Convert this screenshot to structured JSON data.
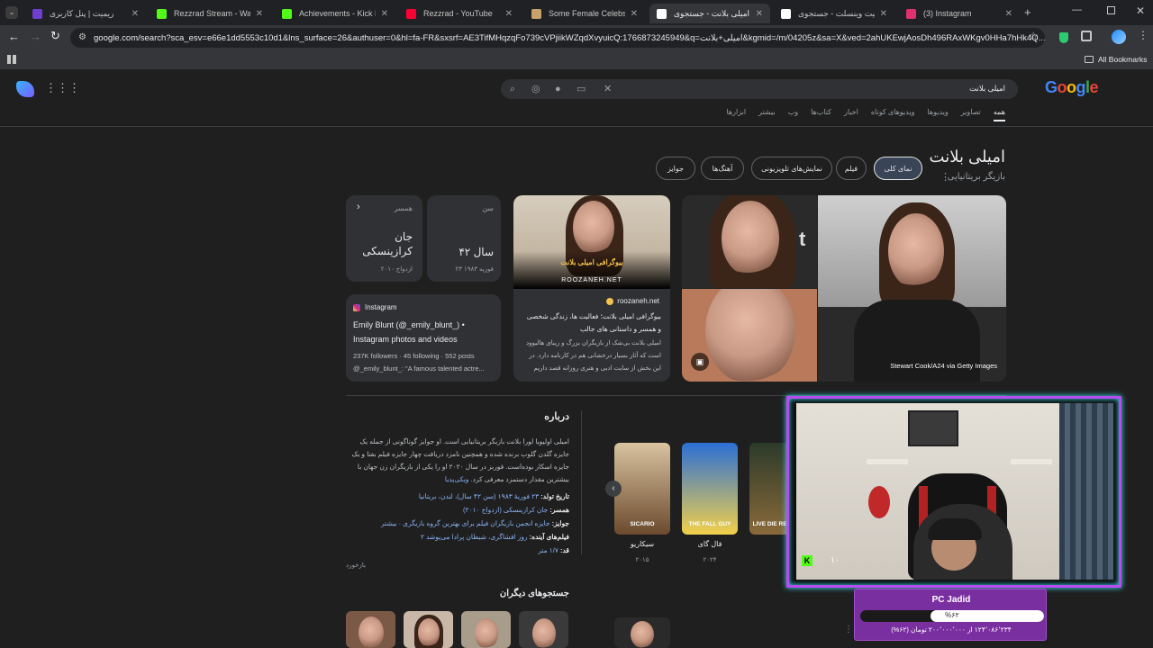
{
  "tabs": [
    {
      "title": "ریمیت | پنل کاربری",
      "color": "#6f3fd1",
      "active": false
    },
    {
      "title": "Rezzrad Stream - Watch L",
      "color": "#53fc18",
      "active": false
    },
    {
      "title": "Achievements - Kick Dash",
      "color": "#53fc18",
      "active": false
    },
    {
      "title": "Rezzrad - YouTube",
      "color": "#ff0033",
      "active": false
    },
    {
      "title": "Some Female Celebs",
      "color": "#c9a26a",
      "active": false
    },
    {
      "title": "امیلی بلانت - جستجوی Goo",
      "color": "#ffffff",
      "active": true
    },
    {
      "title": "کیت وینسلت - جستجوی Goo",
      "color": "#ffffff",
      "active": false
    },
    {
      "title": "(3) Instagram",
      "color": "#e1306c",
      "active": false
    }
  ],
  "address_bar": {
    "url": "google.com/search?sca_esv=e66e1dd5553c10d1&lns_surface=26&authuser=0&hl=fa-FR&sxsrf=AE3TifMHqzqFo739cVPjiikWZqdXvyuicQ:1766873245949&q=امیلی+بلانت&kgmid=/m/04205z&sa=X&ved=2ahUKEwjAosDh496RAxWKgv0HHa7hHk4Q..."
  },
  "bookmarks": {
    "all_label": "All Bookmarks"
  },
  "search": {
    "query": "امیلی بلانت",
    "logo": "Google"
  },
  "nav_tabs": [
    "همه",
    "تصاویر",
    "ویدیوها",
    "ویدیوهای کوتاه",
    "اخبار",
    "کتاب‌ها",
    "وب",
    "بیشتر",
    "ابزارها"
  ],
  "entity": {
    "title": "امیلی بلانت",
    "subtitle": "بازیگر بریتانیایی",
    "chips": [
      "نمای کلی",
      "فیلم",
      "نمایش‌های تلویزیونی",
      "آهنگ‌ها",
      "جوایز"
    ]
  },
  "info_cards": {
    "age": {
      "label": "سن",
      "value": "۴۲ سال",
      "sub": "۲۳ فوریه ۱۹۸۳"
    },
    "spouse": {
      "label": "همسر",
      "value": "جان کرازینسکی",
      "sub": "ازدواج ۲۰۱۰"
    }
  },
  "instagram_card": {
    "source": "Instagram",
    "title": "Emily Blunt (@_emily_blunt_) • Instagram photos and videos",
    "stats": "237K followers · 45 following · 552 posts",
    "snippet": "@_emily_blunt_: \"A famous talented actre..."
  },
  "article_card": {
    "banner": "بیوگرافی امیلی بلانت",
    "watermark": "ROOZANEH.NET",
    "source": "roozaneh.net",
    "title": "بیوگرافی امیلی بلانت؛ فعالیت ها، زندگی شخصی و همسر و داستانی های جالب",
    "snippet": "امیلی بلانت بی‌شک از بازیگران بزرگ و زیبای هالیوود است که آثار بسیار درخشانی هم در کارنامه دارد. در این بخش از سایت ادبی و هنری روزانه قصد داریم نگاهی..."
  },
  "photo_credit": "Stewart Cook/A24 via Getty Images",
  "about": {
    "heading": "درباره",
    "text": "امیلی اولیویا لورا بلانت بازیگر بریتانیایی است. او جوایز گوناگونی از جمله یک جایزه گلدن گلوب برنده شده و همچنین نامزد دریافت چهار جایزه فیلم بفتا و یک جایزه اسکار بوده‌است. فوربز در سال ۲۰۲۰ او را یکی از بازیگران زن جهان با بیشترین مقدار دستمزد معرفی کرد.",
    "link": "ویکی‌پدیا",
    "facts": [
      {
        "label": "تاریخ تولد:",
        "value": "۲۳ فوریهٔ ۱۹۸۳ (سن ۴۲ سال)، لندن، بریتانیا"
      },
      {
        "label": "همسر:",
        "value": "جان کرازینسکی (ازدواج ۲۰۱۰)"
      },
      {
        "label": "جوایز:",
        "value": "جایزه انجمن بازیگران فیلم برای بهترین گروه بازیگری · بیشتر"
      },
      {
        "label": "فیلم‌های آینده:",
        "value": "روز افشاگری، شیطان پرادا می‌پوشد ۲"
      },
      {
        "label": "قد:",
        "value": "۱/۷ متر"
      }
    ],
    "feedback": "بازخورد"
  },
  "movies": [
    {
      "title": "سیکاریو",
      "year": "۲۰۱۵",
      "poster_text": "SICARIO",
      "colors": [
        "#d9c3a0",
        "#6b4a2d"
      ]
    },
    {
      "title": "فال گای",
      "year": "۲۰۲۴",
      "poster_text": "THE FALL GUY",
      "colors": [
        "#2b6fd6",
        "#f2d04a"
      ]
    },
    {
      "title": "",
      "year": "",
      "poster_text": "LIVE DIE REPEAT",
      "colors": [
        "#2c3a2a",
        "#8a6a3a"
      ]
    }
  ],
  "other_searches": {
    "heading": "جستجوهای دیگران"
  },
  "overlay": {
    "channel_badge": "K",
    "viewer_count": "۱۰",
    "donation_title": "PC Jadid",
    "donation_percent": "%۶۲",
    "donation_progress": 0.62,
    "donation_amount": "۱۲۴٬۰۸۶٬۲۳۴ از ۲۰۰٬۰۰۰٬۰۰۰ تومان (۶۲%)",
    "frame_color": "#b84bf2",
    "glow_color": "#35e6f5"
  }
}
